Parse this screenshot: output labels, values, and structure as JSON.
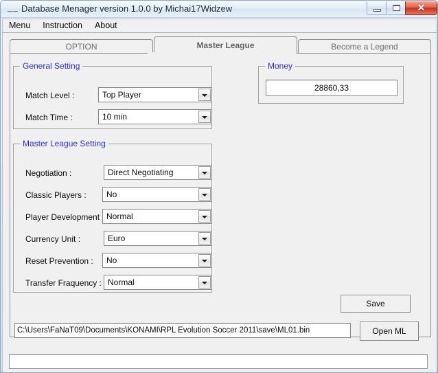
{
  "window": {
    "title": "Database Menager version 1.0.0 by Michai17Widzew",
    "app_icon": "app-icon",
    "controls": {
      "minimize": "minimize-icon",
      "maximize": "maximize-icon",
      "close": "✕"
    }
  },
  "menubar": {
    "items": [
      {
        "label": "Menu"
      },
      {
        "label": "Instruction"
      },
      {
        "label": "About"
      }
    ]
  },
  "tabs": [
    {
      "label": "OPTION",
      "selected": false
    },
    {
      "label": "Master League",
      "selected": true
    },
    {
      "label": "Become a Legend",
      "selected": false
    }
  ],
  "general_setting": {
    "title": "General Setting",
    "fields": [
      {
        "label": "Match Level :",
        "value": "Top Player"
      },
      {
        "label": "Match Time :",
        "value": "10 min"
      }
    ]
  },
  "money": {
    "title": "Money",
    "value": "28860,33"
  },
  "master_league_setting": {
    "title": "Master League Setting",
    "fields": [
      {
        "label": "Negotiation :",
        "value": "Direct Negotiating"
      },
      {
        "label": "Classic Players :",
        "value": "No"
      },
      {
        "label": "Player Development :",
        "value": "Normal"
      },
      {
        "label": "Currency Unit :",
        "value": "Euro"
      },
      {
        "label": "Reset Prevention :",
        "value": "No"
      },
      {
        "label": "Transfer Fraquency :",
        "value": "Normal"
      }
    ]
  },
  "actions": {
    "save_label": "Save",
    "open_ml_label": "Open ML"
  },
  "file_path": {
    "value": "C:\\Users\\FaNaT09\\Documents\\KONAMI\\RPL Evolution Soccer 2011\\save\\ML01.bin"
  },
  "status_bar": {
    "value": ""
  },
  "colors": {
    "group_title": "#2b2be0",
    "panel_bg": "#f0f0f0",
    "close_button": "#c6311f",
    "tab_text": "#6d6d6d"
  }
}
